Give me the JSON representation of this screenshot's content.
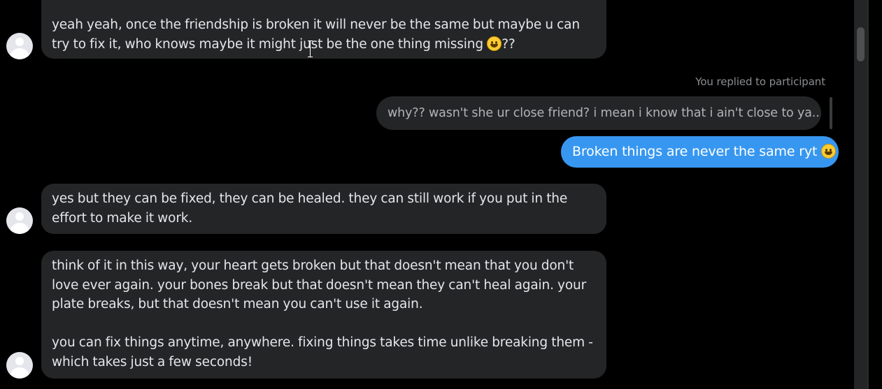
{
  "messages": [
    {
      "direction": "incoming",
      "lines": [
        "yeah yeah, once the friendship is broken it will never be the same but maybe u can",
        "try to fix it, who knows maybe it might just be the one thing missing "
      ],
      "trailing_text": "??",
      "emoji": "smiling-face-emoji"
    },
    {
      "direction": "incoming",
      "lines": [
        "yes but they can be fixed, they can be healed. they can still work if you put in the",
        "effort to make it work."
      ]
    },
    {
      "direction": "incoming",
      "paragraphs": [
        [
          "think of it in this way, your heart gets broken but that doesn't mean that you don't",
          "love ever again. your bones break but that doesn't mean they can't heal again. your",
          "plate breaks, but that doesn't mean you can't use it again."
        ],
        [
          "you can fix things anytime, anywhere. fixing things takes time unlike breaking them -",
          "which takes just a few seconds!"
        ]
      ]
    }
  ],
  "reply": {
    "label": "You replied to participant",
    "quoted_text": "why?? wasn't she ur close friend? i mean i know that i ain't close to ya..."
  },
  "outgoing": {
    "text": "Broken things are never the same ryt ",
    "emoji": "smiling-face-emoji",
    "color": "#3797f0"
  },
  "colors": {
    "background": "#000000",
    "incoming_bubble": "#242526",
    "text": "#e4e6eb"
  }
}
